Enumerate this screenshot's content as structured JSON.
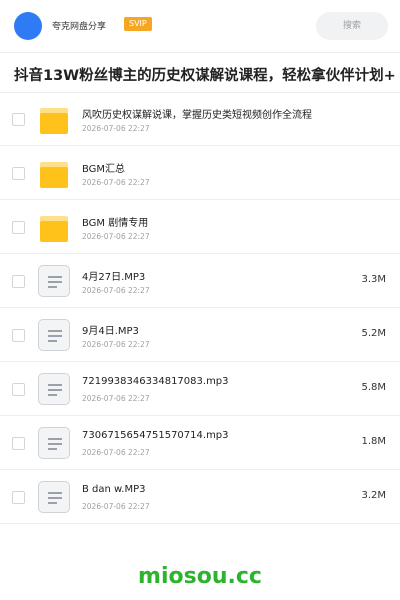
{
  "header": {
    "owner": "夸克网盘分享",
    "badge": "SVIP",
    "search_placeholder": "搜索"
  },
  "page_title": "抖音13W粉丝博主的历史权谋解说课程，轻松拿伙伴计划+",
  "files": [
    {
      "type": "folder",
      "name": "风吹历史权谋解说课，掌握历史类短视频创作全流程",
      "date": "2026-07-06 22:27",
      "size": ""
    },
    {
      "type": "folder",
      "name": "BGM汇总",
      "date": "2026-07-06 22:27",
      "size": ""
    },
    {
      "type": "folder",
      "name": "BGM 剧情专用",
      "date": "2026-07-06 22:27",
      "size": ""
    },
    {
      "type": "audio",
      "name": "4月27日.MP3",
      "date": "2026-07-06 22:27",
      "size": "3.3M"
    },
    {
      "type": "audio",
      "name": "9月4日.MP3",
      "date": "2026-07-06 22:27",
      "size": "5.2M"
    },
    {
      "type": "audio",
      "name": "7219938346334817083.mp3",
      "date": "2026-07-06 22:27",
      "size": "5.8M"
    },
    {
      "type": "audio",
      "name": "7306715654751570714.mp3",
      "date": "2026-07-06 22:27",
      "size": "1.8M"
    },
    {
      "type": "audio",
      "name": "B  dan  w.MP3",
      "date": "2026-07-06 22:27",
      "size": "3.2M"
    }
  ],
  "watermark": "miosou.cc",
  "colors": {
    "avatar": "#2f7bf5",
    "badge": "#f5a623",
    "folder": "#ffc21a",
    "watermark": "#2cb52c"
  }
}
